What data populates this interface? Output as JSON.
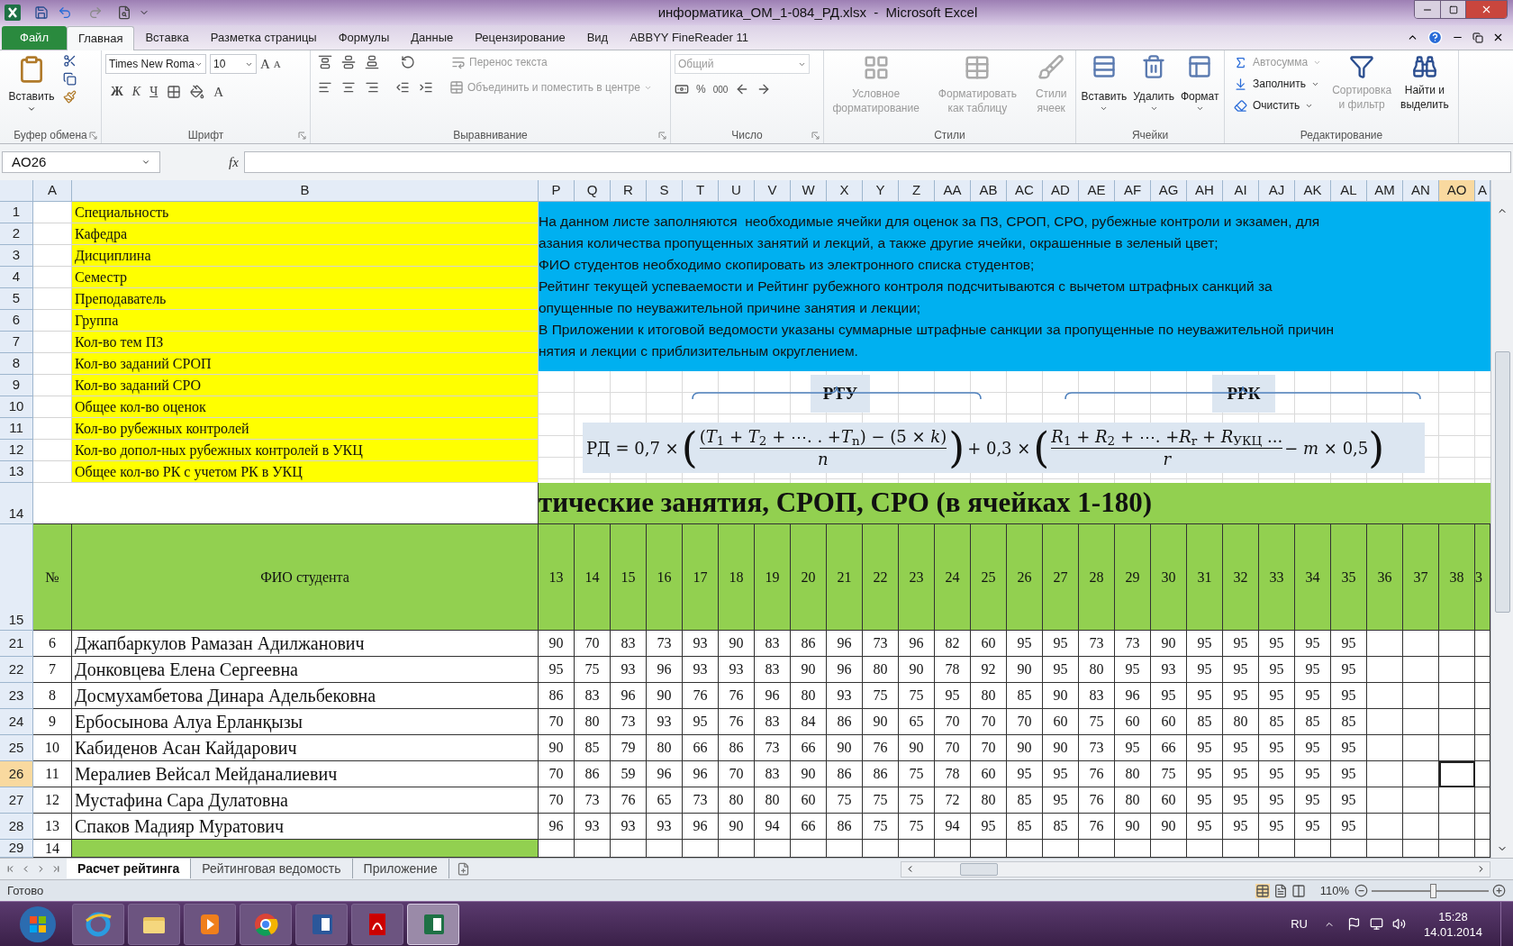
{
  "window": {
    "title": "информатика_ОМ_1-084_РД.xlsx  -  Microsoft Excel"
  },
  "ribbon_tabs": [
    {
      "label": "Файл",
      "kind": "file",
      "selected": false
    },
    {
      "label": "Главная",
      "kind": "tab",
      "selected": true
    },
    {
      "label": "Вставка",
      "kind": "tab",
      "selected": false
    },
    {
      "label": "Разметка страницы",
      "kind": "tab",
      "selected": false
    },
    {
      "label": "Формулы",
      "kind": "tab",
      "selected": false
    },
    {
      "label": "Данные",
      "kind": "tab",
      "selected": false
    },
    {
      "label": "Рецензирование",
      "kind": "tab",
      "selected": false
    },
    {
      "label": "Вид",
      "kind": "tab",
      "selected": false
    },
    {
      "label": "ABBYY FineReader 11",
      "kind": "tab",
      "selected": false
    }
  ],
  "ribbon": {
    "clipboard": {
      "label": "Буфер обмена",
      "paste": "Вставить"
    },
    "font": {
      "label": "Шрифт",
      "font_name": "Times New Roma",
      "font_size": "10",
      "grow": "A",
      "shrink": "A",
      "styles": [
        "Ж",
        "К",
        "Ч"
      ],
      "font_color": "A"
    },
    "alignment": {
      "label": "Выравнивание",
      "wrap": {
        "label": "Перенос текста",
        "disabled": true
      },
      "merge": {
        "label": "Объединить и поместить в центре",
        "disabled": true
      }
    },
    "number": {
      "label": "Число",
      "format": {
        "label": "Общий",
        "disabled": true
      },
      "percent": "%",
      "thousands": "000"
    },
    "styles": {
      "label": "Стили",
      "buttons": [
        {
          "lines": [
            "Условное",
            "форматирование"
          ],
          "disabled": true
        },
        {
          "lines": [
            "Форматировать",
            "как таблицу"
          ],
          "disabled": true
        },
        {
          "lines": [
            "Стили",
            "ячеек"
          ],
          "disabled": true
        }
      ]
    },
    "cells": {
      "label": "Ячейки",
      "buttons": [
        {
          "label": "Вставить",
          "kind": "insert",
          "disabled": false
        },
        {
          "label": "Удалить",
          "kind": "delete",
          "disabled": false
        },
        {
          "label": "Формат",
          "kind": "format",
          "disabled": false
        }
      ]
    },
    "editing": {
      "label": "Редактирование",
      "small": [
        {
          "label": "Автосумма",
          "kind": "sum",
          "disabled": true
        },
        {
          "label": "Заполнить",
          "kind": "fill",
          "disabled": false
        },
        {
          "label": "Очистить",
          "kind": "clear",
          "disabled": false
        }
      ],
      "big": [
        {
          "lines": [
            "Сортировка",
            "и фильтр"
          ],
          "kind": "sort",
          "disabled": true
        },
        {
          "lines": [
            "Найти и",
            "выделить"
          ],
          "kind": "find",
          "disabled": false
        }
      ]
    }
  },
  "formula_bar": {
    "name_box": "AO26",
    "fx": "fx"
  },
  "columns": [
    {
      "label": "A",
      "selected": false
    },
    {
      "label": "B",
      "selected": false
    },
    {
      "label": "P",
      "selected": false
    },
    {
      "label": "Q",
      "selected": false
    },
    {
      "label": "R",
      "selected": false
    },
    {
      "label": "S",
      "selected": false
    },
    {
      "label": "T",
      "selected": false
    },
    {
      "label": "U",
      "selected": false
    },
    {
      "label": "V",
      "selected": false
    },
    {
      "label": "W",
      "selected": false
    },
    {
      "label": "X",
      "selected": false
    },
    {
      "label": "Y",
      "selected": false
    },
    {
      "label": "Z",
      "selected": false
    },
    {
      "label": "AA",
      "selected": false
    },
    {
      "label": "AB",
      "selected": false
    },
    {
      "label": "AC",
      "selected": false
    },
    {
      "label": "AD",
      "selected": false
    },
    {
      "label": "AE",
      "selected": false
    },
    {
      "label": "AF",
      "selected": false
    },
    {
      "label": "AG",
      "selected": false
    },
    {
      "label": "AH",
      "selected": false
    },
    {
      "label": "AI",
      "selected": false
    },
    {
      "label": "AJ",
      "selected": false
    },
    {
      "label": "AK",
      "selected": false
    },
    {
      "label": "AL",
      "selected": false
    },
    {
      "label": "AM",
      "selected": false
    },
    {
      "label": "AN",
      "selected": false
    },
    {
      "label": "AO",
      "selected": true
    },
    {
      "label": "A",
      "selected": false
    }
  ],
  "settings_rows": [
    {
      "row": "1",
      "label": "Специальность"
    },
    {
      "row": "2",
      "label": "Кафедра"
    },
    {
      "row": "3",
      "label": "Дисциплина"
    },
    {
      "row": "4",
      "label": "Семестр"
    },
    {
      "row": "5",
      "label": "Преподаватель"
    },
    {
      "row": "6",
      "label": "Группа"
    },
    {
      "row": "7",
      "label": "Кол-во тем ПЗ"
    },
    {
      "row": "8",
      "label": "Кол-во заданий СРОП"
    },
    {
      "row": "9",
      "label": "Кол-во заданий СРО"
    },
    {
      "row": "10",
      "label": "Общее кол-во оценок"
    },
    {
      "row": "11",
      "label": "Кол-во рубежных контролей"
    },
    {
      "row": "12",
      "label": "Кол-во допол-ных рубежных контролей в УКЦ"
    },
    {
      "row": "13",
      "label": "Общее кол-во РК с учетом РК в УКЦ"
    }
  ],
  "instructions": [
    "На данном листе заполняются  необходимые ячейки для оценок за ПЗ, СРОП, СРО, рубежные контроли и экзамен, для",
    "азания количества пропущенных занятий и лекций, а также другие ячейки, окрашенные в зеленый цвет;",
    "ФИО студентов необходимо скопировать из электронного списка студентов;",
    "Рейтинг текущей успеваемости и Рейтинг рубежного контроля подсчитываются с вычетом штрафных санкций за",
    "опущенные по неуважительной причине занятия и лекции;",
    "В Приложении к итоговой ведомости указаны суммарные штрафные санкции за пропущенные по неуважительной причин",
    "нятия и лекции с приблизительным округлением."
  ],
  "formula": {
    "label_1": "РТУ",
    "label_2": "РРК",
    "lhs": "РД = 0,7 ×",
    "open_1": "(",
    "num_1": "(*T*$_{1}$ + *T*$_{2}$ + ⋯. . +*T*$_{n}$) − (5 × *k*)",
    "den_1": "*n*",
    "close_1": ")",
    "middle": "+ 0,3 ×",
    "open_2": "(",
    "num_2": "*R*$_{1}$ + *R*$_{2}$ + ⋯. +*R*$_{r}$ + *R*$_{УКЦ}$ ...",
    "den_2": "*r*",
    "tail": "− *m* × 0,5",
    "close_2": ")"
  },
  "section_row": {
    "row": "14",
    "heading": "тические занятия, СРОП, СРО (в ячейках 1-180)"
  },
  "header_row": {
    "row": "15",
    "number": "№",
    "name": "ФИО студента",
    "lessons": [
      "13",
      "14",
      "15",
      "16",
      "17",
      "18",
      "19",
      "20",
      "21",
      "22",
      "23",
      "24",
      "25",
      "26",
      "27",
      "28",
      "29",
      "30",
      "31",
      "32",
      "33",
      "34",
      "35",
      "36",
      "37",
      "38",
      "3"
    ]
  },
  "students": [
    {
      "row": "21",
      "selected": false,
      "number": "6",
      "name": "Джапбаркулов Рамазан Адилжанович",
      "grades": [
        "90",
        "70",
        "83",
        "73",
        "93",
        "90",
        "83",
        "86",
        "96",
        "73",
        "96",
        "82",
        "60",
        "95",
        "95",
        "73",
        "73",
        "90",
        "95",
        "95",
        "95",
        "95",
        "95"
      ]
    },
    {
      "row": "22",
      "selected": false,
      "number": "7",
      "name": "Донковцева Елена Сергеевна",
      "grades": [
        "95",
        "75",
        "93",
        "96",
        "93",
        "93",
        "83",
        "90",
        "96",
        "80",
        "90",
        "78",
        "92",
        "90",
        "95",
        "80",
        "95",
        "93",
        "95",
        "95",
        "95",
        "95",
        "95"
      ]
    },
    {
      "row": "23",
      "selected": false,
      "number": "8",
      "name": "Досмухамбетова Динара Адельбековна",
      "grades": [
        "86",
        "83",
        "96",
        "90",
        "76",
        "76",
        "96",
        "80",
        "93",
        "75",
        "75",
        "95",
        "80",
        "85",
        "90",
        "83",
        "96",
        "95",
        "95",
        "95",
        "95",
        "95",
        "95"
      ]
    },
    {
      "row": "24",
      "selected": false,
      "number": "9",
      "name": "Ербосынова Алуа Ерланқызы",
      "grades": [
        "70",
        "80",
        "73",
        "93",
        "95",
        "76",
        "83",
        "84",
        "86",
        "90",
        "65",
        "70",
        "70",
        "70",
        "60",
        "75",
        "60",
        "60",
        "85",
        "80",
        "85",
        "85",
        "85"
      ]
    },
    {
      "row": "25",
      "selected": false,
      "number": "10",
      "name": "Кабиденов Асан Кайдарович",
      "grades": [
        "90",
        "85",
        "79",
        "80",
        "66",
        "86",
        "73",
        "66",
        "90",
        "76",
        "90",
        "70",
        "70",
        "90",
        "90",
        "73",
        "95",
        "66",
        "95",
        "95",
        "95",
        "95",
        "95"
      ]
    },
    {
      "row": "26",
      "selected": true,
      "number": "11",
      "name": "Мералиев Вейсал Мейданалиевич",
      "grades": [
        "70",
        "86",
        "59",
        "96",
        "96",
        "70",
        "83",
        "90",
        "86",
        "86",
        "75",
        "78",
        "60",
        "95",
        "95",
        "76",
        "80",
        "75",
        "95",
        "95",
        "95",
        "95",
        "95"
      ]
    },
    {
      "row": "27",
      "selected": false,
      "number": "12",
      "name": "Мустафина Сара Дулатовна",
      "grades": [
        "70",
        "73",
        "76",
        "65",
        "73",
        "80",
        "80",
        "60",
        "75",
        "75",
        "75",
        "72",
        "80",
        "85",
        "95",
        "76",
        "80",
        "60",
        "95",
        "95",
        "95",
        "95",
        "95"
      ]
    },
    {
      "row": "28",
      "selected": false,
      "number": "13",
      "name": "Спаков Мадияр Муратович",
      "grades": [
        "96",
        "93",
        "93",
        "93",
        "96",
        "90",
        "94",
        "66",
        "86",
        "75",
        "75",
        "94",
        "95",
        "85",
        "85",
        "76",
        "90",
        "90",
        "95",
        "95",
        "95",
        "95",
        "95"
      ]
    },
    {
      "row": "29",
      "selected": false,
      "number": "14",
      "kind": "blank"
    }
  ],
  "sheet_tabs": [
    {
      "label": "Расчет рейтинга",
      "selected": true
    },
    {
      "label": "Рейтинговая ведомость",
      "selected": false
    },
    {
      "label": "Приложение",
      "selected": false
    }
  ],
  "status_bar": {
    "status": "Готово",
    "zoom": "110%",
    "level": 0.53
  },
  "taskbar": {
    "apps": [
      {
        "kind": "ie",
        "active": false
      },
      {
        "kind": "folder",
        "active": false
      },
      {
        "kind": "media",
        "active": false
      },
      {
        "kind": "chrome",
        "active": false
      },
      {
        "kind": "word",
        "active": false
      },
      {
        "kind": "pdf",
        "active": false
      },
      {
        "kind": "excel",
        "active": true
      }
    ],
    "language": "RU",
    "time": "15:28",
    "date": "14.01.2014"
  }
}
